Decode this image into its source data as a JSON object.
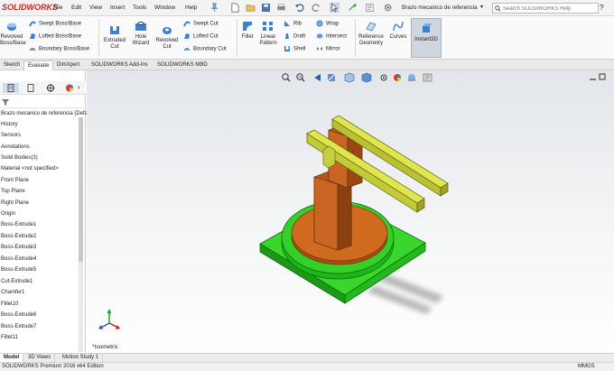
{
  "app": {
    "logo": "SOLIDWORKS",
    "document_title": "Brazo mecanico de referencia"
  },
  "menu": [
    "File",
    "Edit",
    "View",
    "Insert",
    "Tools",
    "Window",
    "Help"
  ],
  "search": {
    "placeholder": "Search SOLIDWORKS Help"
  },
  "help_label": "?",
  "ribbon": {
    "revolved_boss": "Revolved\nBoss/Base",
    "swept_boss": "Swept Boss/Base",
    "lofted_boss": "Lofted Boss/Base",
    "boundary_boss": "Boundary Boss/Base",
    "extruded_cut": "Extruded\nCut",
    "hole_wizard": "Hole\nWizard",
    "revolved_cut": "Revolved\nCut",
    "swept_cut": "Swept Cut",
    "lofted_cut": "Lofted Cut",
    "boundary_cut": "Boundary Cut",
    "fillet": "Fillet",
    "linear_pattern": "Linear\nPattern",
    "rib": "Rib",
    "draft": "Draft",
    "shell": "Shell",
    "wrap": "Wrap",
    "intersect": "Intersect",
    "mirror": "Mirror",
    "reference_geometry": "Reference\nGeometry",
    "curves": "Curves",
    "instant3d": "Instant3D"
  },
  "tabs": [
    "Sketch",
    "Evaluate",
    "DimXpert",
    "SOLIDWORKS Add-Ins",
    "SOLIDWORKS MBD"
  ],
  "tree": [
    "Brazo mecanico de referencia  (Default",
    "History",
    "Sensors",
    "Annotations",
    "Solid Bodies(3)",
    "Material <not specified>",
    "Front Plane",
    "Top Plane",
    "Right Plane",
    "Origin",
    "Boss-Extrude1",
    "Boss-Extrude2",
    "Boss-Extrude3",
    "Boss-Extrude4",
    "Boss-Extrude5",
    "Cut-Extrude1",
    "Chamfer1",
    "Fillet10",
    "Boss-Extrude6",
    "Boss-Extrude7",
    "Fillet11"
  ],
  "view": {
    "label": "*Isometric"
  },
  "bottom_tabs": [
    "Model",
    "3D Views",
    "Motion Study 1"
  ],
  "status": {
    "left": "SOLIDWORKS Premium 2016 x64 Edition",
    "units": "MMGS"
  },
  "colors": {
    "base": "#2fd42f",
    "disc": "#d2691e",
    "column": "#b4571a",
    "arms": "#cfd94a",
    "accent": "#d42020"
  }
}
